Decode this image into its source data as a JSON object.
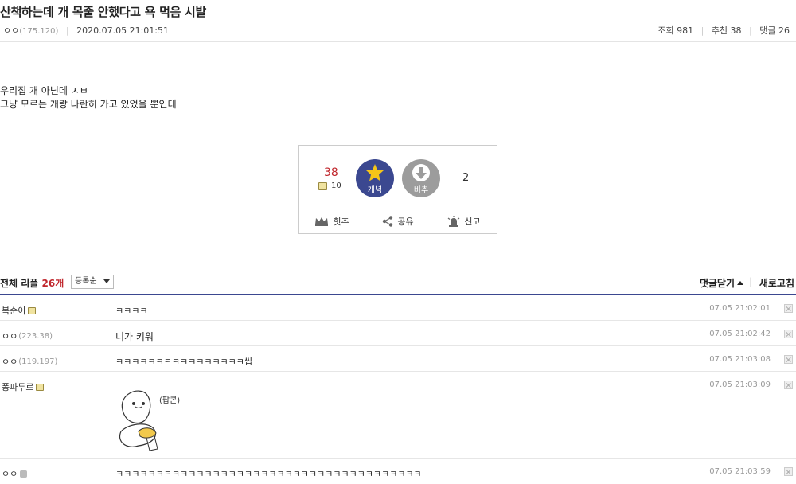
{
  "post": {
    "title": "산책하는데 개 목줄 안했다고 욕 먹음 시발",
    "author": "ㅇㅇ",
    "author_ip": "(175.120)",
    "datetime": "2020.07.05 21:01:51",
    "views_label": "조회 981",
    "recommend_label": "추천 38",
    "comments_label": "댓글 26",
    "body_lines": [
      "우리집 개 아닌데 ㅅㅂ",
      "그냥 모르는 개랑 나란히 가고 있었을 뿐인데"
    ]
  },
  "vote": {
    "up_count": "38",
    "fixed_count": "10",
    "up_label": "개념",
    "down_label": "비추",
    "down_count": "2",
    "actions": [
      "힛추",
      "공유",
      "신고"
    ]
  },
  "comments_header": {
    "label": "전체 리플",
    "count": "26개",
    "sort": "등록순",
    "close_label": "댓글닫기",
    "refresh_label": "새로고침"
  },
  "comments": [
    {
      "nick": "복순이",
      "ip": "",
      "text": "ㅋㅋㅋㅋ",
      "date": "07.05 21:02:01"
    },
    {
      "nick": "ㅇㅇ",
      "ip": "(223.38)",
      "text": "니가 키워",
      "date": "07.05 21:02:42"
    },
    {
      "nick": "ㅇㅇ",
      "ip": "(119.197)",
      "text": "ㅋㅋㅋㅋㅋㅋㅋㅋㅋㅋㅋㅋㅋㅋㅋㅋ씹",
      "date": "07.05 21:03:08"
    },
    {
      "nick": "퐁파두르",
      "ip": "",
      "text": "",
      "date": "07.05 21:03:09"
    },
    {
      "nick": "ㅇㅇ",
      "ip": "",
      "text": "ㅋㅋㅋㅋㅋㅋㅋㅋㅋㅋㅋㅋㅋㅋㅋㅋㅋㅋㅋㅋㅋㅋㅋㅋㅋㅋㅋㅋㅋㅋㅋㅋㅋㅋㅋㅋㅋㅋ",
      "date": "07.05 21:03:59"
    }
  ],
  "doodle_text": "(팝콘)",
  "colors": {
    "accent": "#3b4890",
    "red": "#c0272d",
    "gray_btn": "#9c9c9c"
  }
}
